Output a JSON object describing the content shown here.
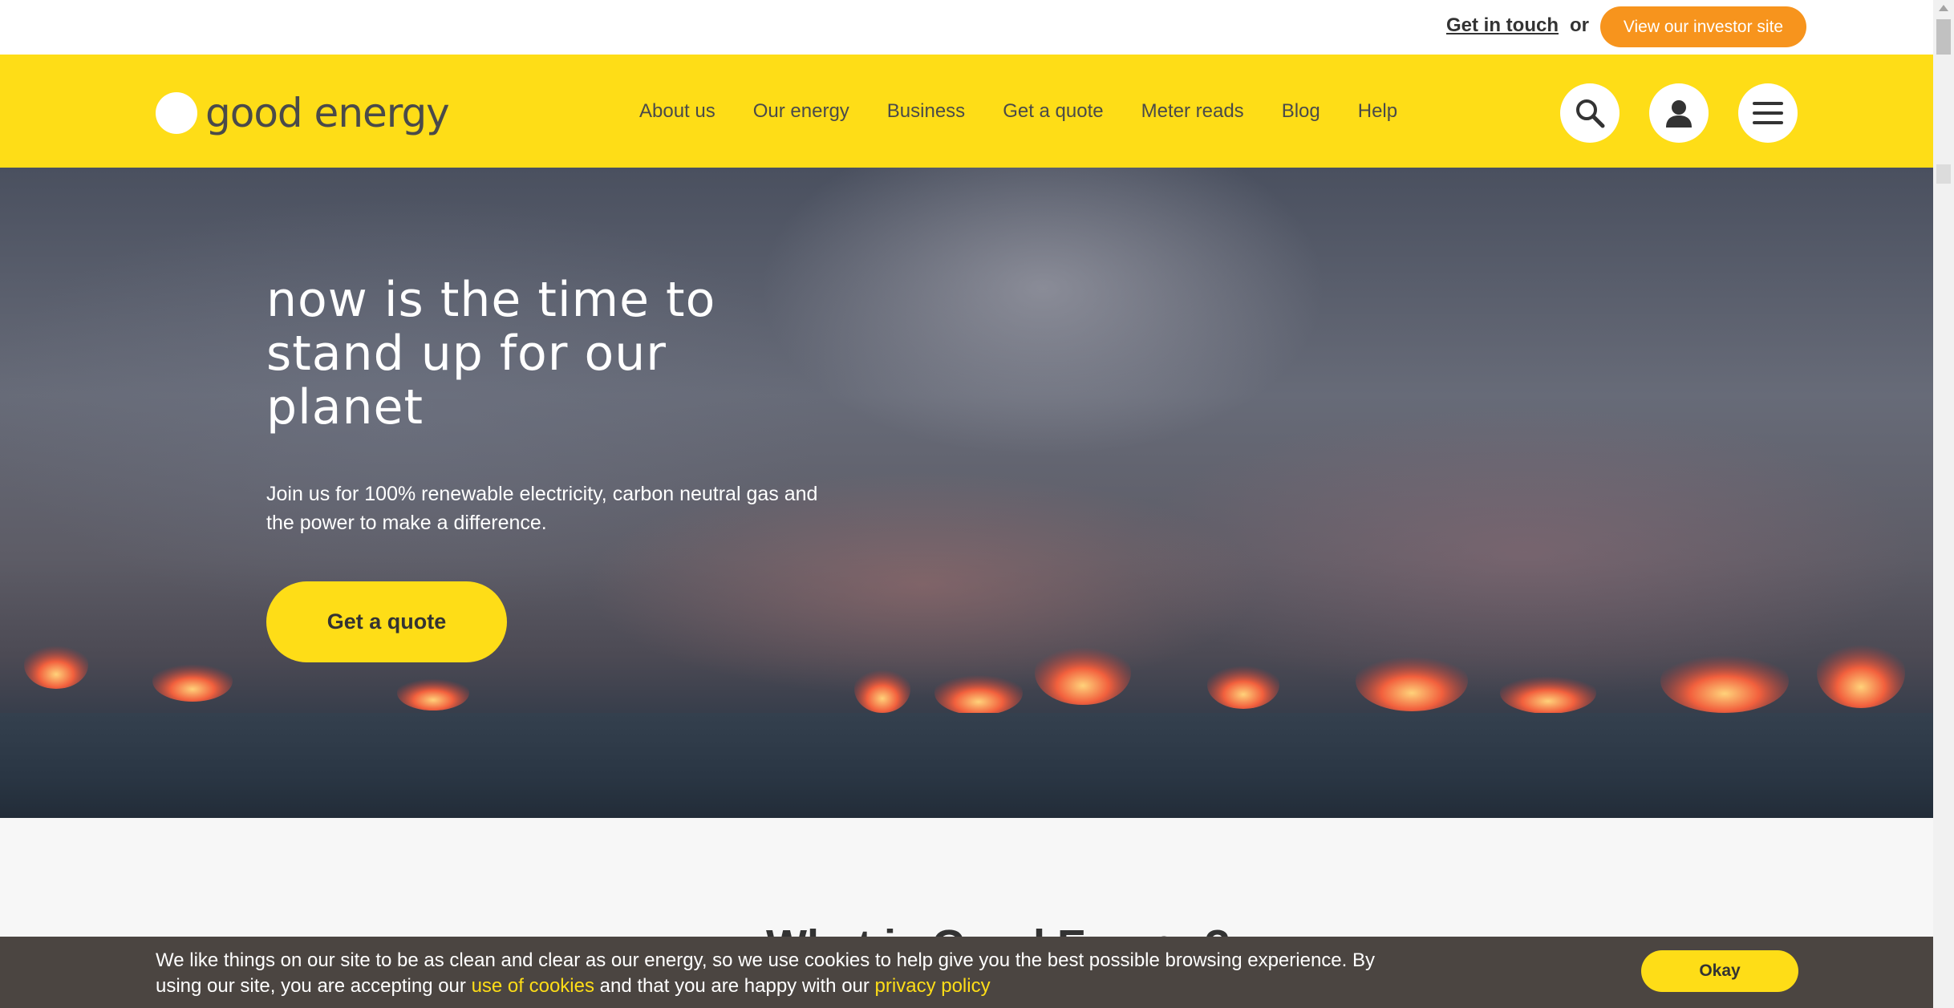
{
  "topbar": {
    "contact_link": "Get in touch",
    "or_text": "or",
    "investor_button": "View our investor site"
  },
  "header": {
    "logo_text": "good energy",
    "nav": [
      {
        "label": "About us"
      },
      {
        "label": "Our energy"
      },
      {
        "label": "Business"
      },
      {
        "label": "Get a quote"
      },
      {
        "label": "Meter reads"
      },
      {
        "label": "Blog"
      },
      {
        "label": "Help"
      }
    ],
    "icons": [
      "search-icon",
      "account-icon",
      "menu-icon"
    ]
  },
  "hero": {
    "title": "now is the time to stand up for our planet",
    "subtitle": "Join us for 100% renewable electricity, carbon neutral gas and the power to make a difference.",
    "cta": "Get a quote"
  },
  "section": {
    "title_partial": "What is Good Energy?"
  },
  "cookie": {
    "text_1": "We like things on our site to be as clean and clear as our energy, so we use cookies to help give you the best possible browsing experience. By using our site, you are accepting our ",
    "link_cookies": "use of cookies",
    "text_2": " and that you are happy with our ",
    "link_privacy": "privacy policy",
    "okay_button": "Okay"
  },
  "colors": {
    "brand_yellow": "#fedd17",
    "investor_orange": "#f7941d",
    "cookie_bg": "#4b4541",
    "text_dark": "#4a4a4a"
  }
}
